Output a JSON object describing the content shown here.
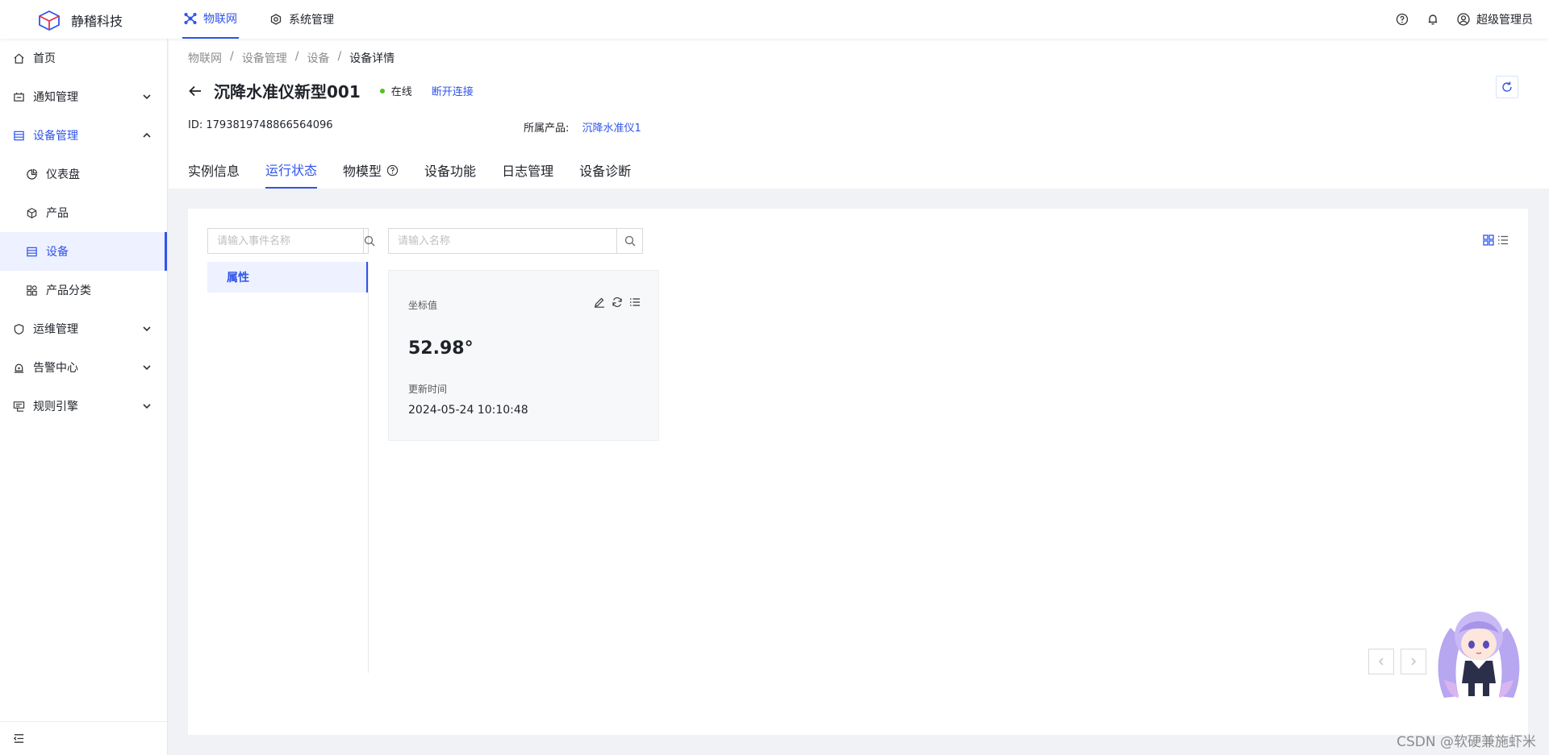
{
  "header": {
    "brand": "静稽科技",
    "nav": [
      {
        "label": "物联网",
        "active": true
      },
      {
        "label": "系统管理",
        "active": false
      }
    ],
    "user": "超级管理员"
  },
  "sidebar": {
    "items": [
      {
        "label": "首页"
      },
      {
        "label": "通知管理"
      },
      {
        "label": "设备管理"
      },
      {
        "label": "仪表盘"
      },
      {
        "label": "产品"
      },
      {
        "label": "设备"
      },
      {
        "label": "产品分类"
      },
      {
        "label": "运维管理"
      },
      {
        "label": "告警中心"
      },
      {
        "label": "规则引擎"
      }
    ]
  },
  "breadcrumb": [
    "物联网",
    "设备管理",
    "设备",
    "设备详情"
  ],
  "device": {
    "name": "沉降水准仪新型001",
    "status": "在线",
    "disconnect": "断开连接",
    "id_label": "ID:",
    "id": "1793819748866564096",
    "product_label": "所属产品:",
    "product": "沉降水准仪1"
  },
  "tabs": [
    "实例信息",
    "运行状态",
    "物模型",
    "设备功能",
    "日志管理",
    "设备诊断"
  ],
  "active_tab": "运行状态",
  "runtime": {
    "event_search_placeholder": "请输入事件名称",
    "name_search_placeholder": "请输入名称",
    "categories": [
      "属性"
    ],
    "property": {
      "name": "坐标值",
      "value": "52.98°",
      "updated_label": "更新时间",
      "updated_time": "2024-05-24 10:10:48"
    }
  },
  "watermark": "CSDN @软硬兼施虾米",
  "colors": {
    "primary": "#2f54eb",
    "online": "#52c41a"
  },
  "icons": [
    "logo-cube-icon",
    "iot-icon",
    "system-icon",
    "help-icon",
    "bell-icon",
    "user-icon",
    "home-icon",
    "notice-icon",
    "device-mgmt-icon",
    "dashboard-icon",
    "product-icon",
    "device-icon",
    "category-icon",
    "ops-icon",
    "alarm-icon",
    "rule-icon",
    "chevron-down-icon",
    "chevron-up-icon",
    "back-arrow-icon",
    "refresh-icon",
    "search-icon",
    "edit-icon",
    "sync-icon",
    "list-icon",
    "grid-view-icon",
    "list-view-icon",
    "menu-fold-icon"
  ]
}
